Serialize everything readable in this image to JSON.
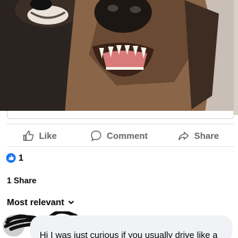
{
  "post": {
    "photo_alt": "",
    "actions": [
      {
        "label": "Like",
        "icon": "thumbs-up-icon"
      },
      {
        "label": "Comment",
        "icon": "comment-icon"
      },
      {
        "label": "Share",
        "icon": "share-arrow-icon"
      }
    ],
    "reaction_count": "1",
    "shares": "1 Share"
  },
  "comments": {
    "sort_label": "Most relevant",
    "first": {
      "text": "Hi I was just curious if you usually drive like a"
    }
  },
  "colors": {
    "accent": "#1877f2",
    "muted": "#65676b",
    "bubble": "#f0f2f5"
  }
}
